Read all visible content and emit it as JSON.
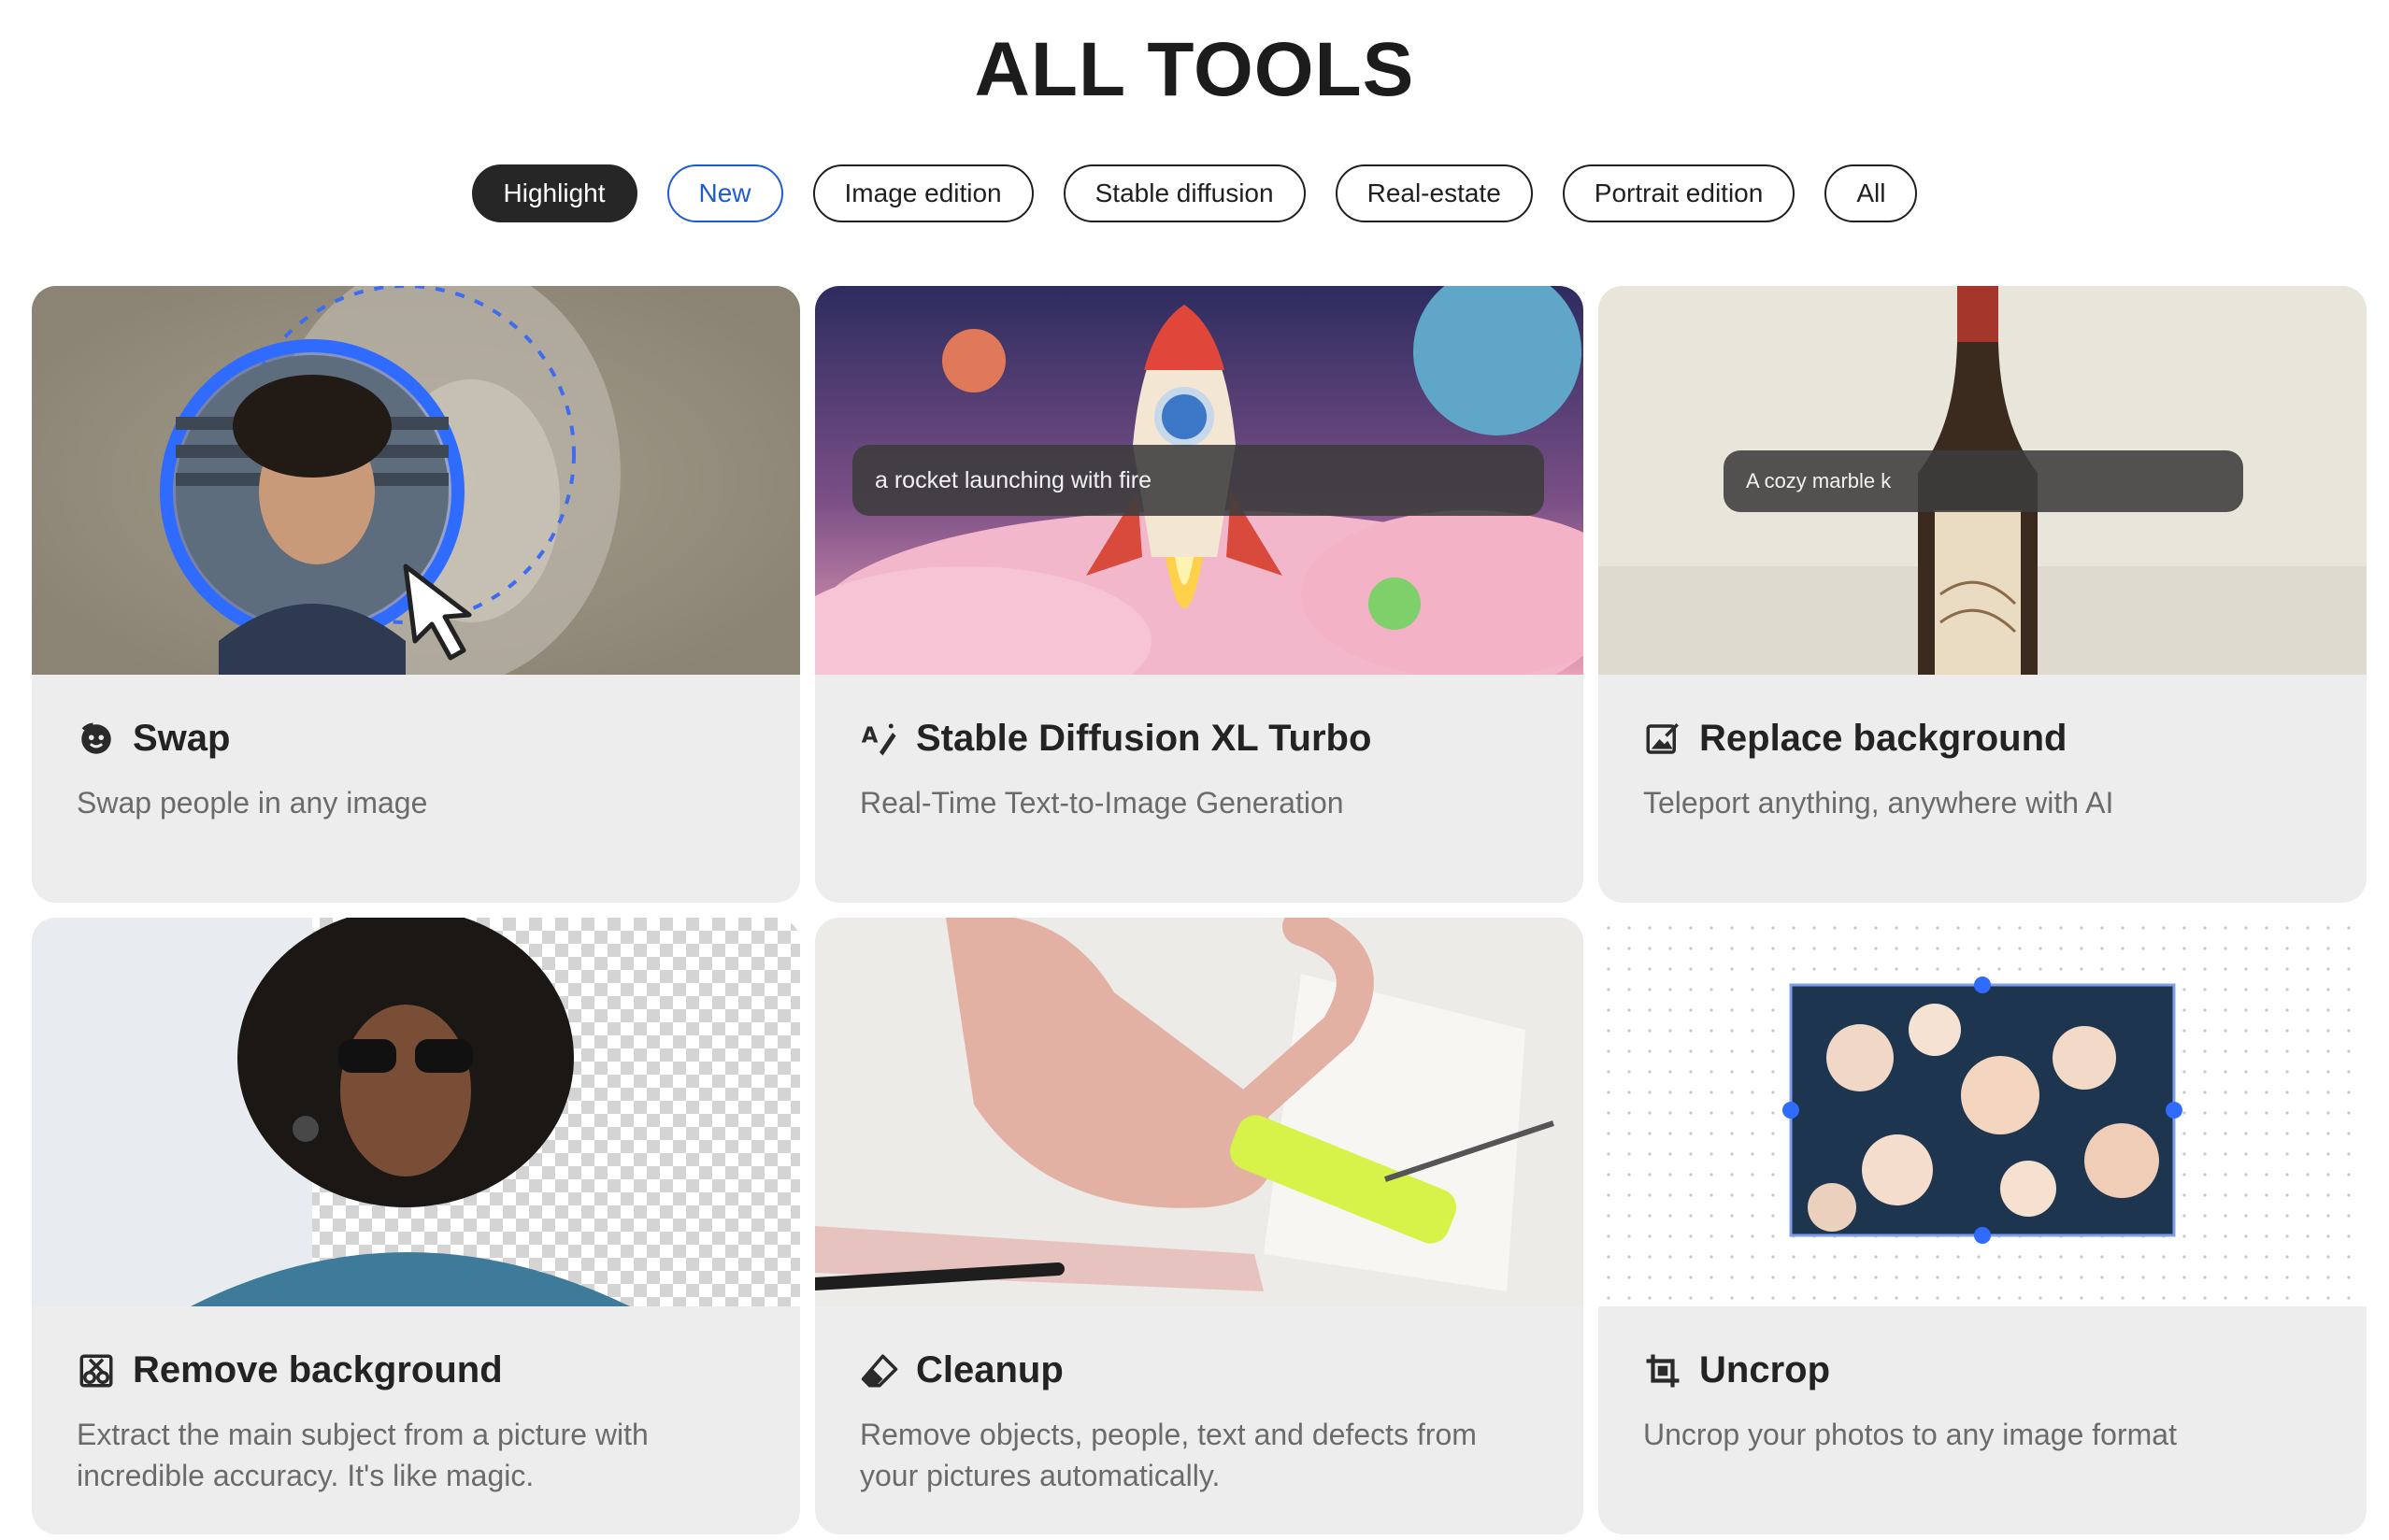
{
  "page": {
    "title": "ALL TOOLS"
  },
  "filters": [
    {
      "label": "Highlight",
      "state": "active"
    },
    {
      "label": "New",
      "state": "new"
    },
    {
      "label": "Image edition",
      "state": ""
    },
    {
      "label": "Stable diffusion",
      "state": ""
    },
    {
      "label": "Real-estate",
      "state": ""
    },
    {
      "label": "Portrait edition",
      "state": ""
    },
    {
      "label": "All",
      "state": ""
    }
  ],
  "tools": [
    {
      "title": "Swap",
      "description": "Swap people in any image",
      "icon": "face-swap-icon"
    },
    {
      "title": "Stable Diffusion XL Turbo",
      "description": "Real-Time Text-to-Image Generation",
      "icon": "text-to-image-icon",
      "prompt": "a rocket launching with fire"
    },
    {
      "title": "Replace background",
      "description": "Teleport anything, anywhere with AI",
      "icon": "replace-background-icon",
      "prompt": "A cozy marble k"
    },
    {
      "title": "Remove background",
      "description": "Extract the main subject from a picture with incredible accuracy. It's like magic.",
      "icon": "remove-background-icon"
    },
    {
      "title": "Cleanup",
      "description": "Remove objects, people, text and defects from your pictures automatically.",
      "icon": "eraser-icon"
    },
    {
      "title": "Uncrop",
      "description": "Uncrop your photos to any image format",
      "icon": "crop-icon"
    }
  ],
  "colors": {
    "accent": "#1e5cd6",
    "selection_blue": "#2f6bff",
    "card_bg": "#ededed"
  }
}
